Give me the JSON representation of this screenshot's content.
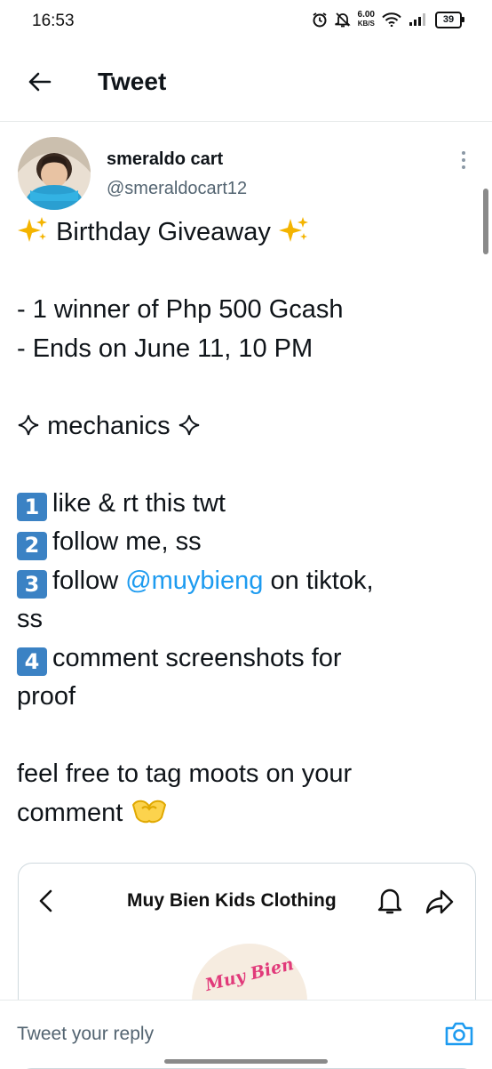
{
  "status_bar": {
    "time": "16:53",
    "net_speed_value": "6.00",
    "net_speed_unit": "KB/S",
    "battery": "39",
    "icons": [
      "alarm-icon",
      "bell-muted-icon",
      "wifi-icon",
      "signal-icon",
      "battery-icon"
    ]
  },
  "header": {
    "title": "Tweet"
  },
  "tweet": {
    "author_name": "smeraldo cart",
    "author_handle": "@smeraldocart12",
    "title_line": "Birthday Giveaway",
    "prize_line": "- 1 winner of Php 500 Gcash",
    "ends_line": "- Ends on June 11, 10 PM",
    "mechanics_label": "mechanics",
    "steps": {
      "s1": {
        "num": "1",
        "text": "like & rt this twt"
      },
      "s2": {
        "num": "2",
        "text": "follow me, ss"
      },
      "s3": {
        "num": "3",
        "before": "follow ",
        "mention": "@muybieng",
        "after": " on tiktok,",
        "wrap": "ss"
      },
      "s4": {
        "num": "4",
        "text": "comment screenshots for",
        "wrap": "proof"
      }
    },
    "closing_line1": "feel free to tag moots on your",
    "closing_line2": "comment"
  },
  "card": {
    "title": "Muy Bien Kids Clothing",
    "logo_text": "Muy Bien"
  },
  "reply": {
    "placeholder": "Tweet your reply"
  },
  "colors": {
    "accent": "#1d9bf0",
    "text": "#0f1419",
    "secondary": "#536471",
    "keycap": "#3b82c4"
  }
}
